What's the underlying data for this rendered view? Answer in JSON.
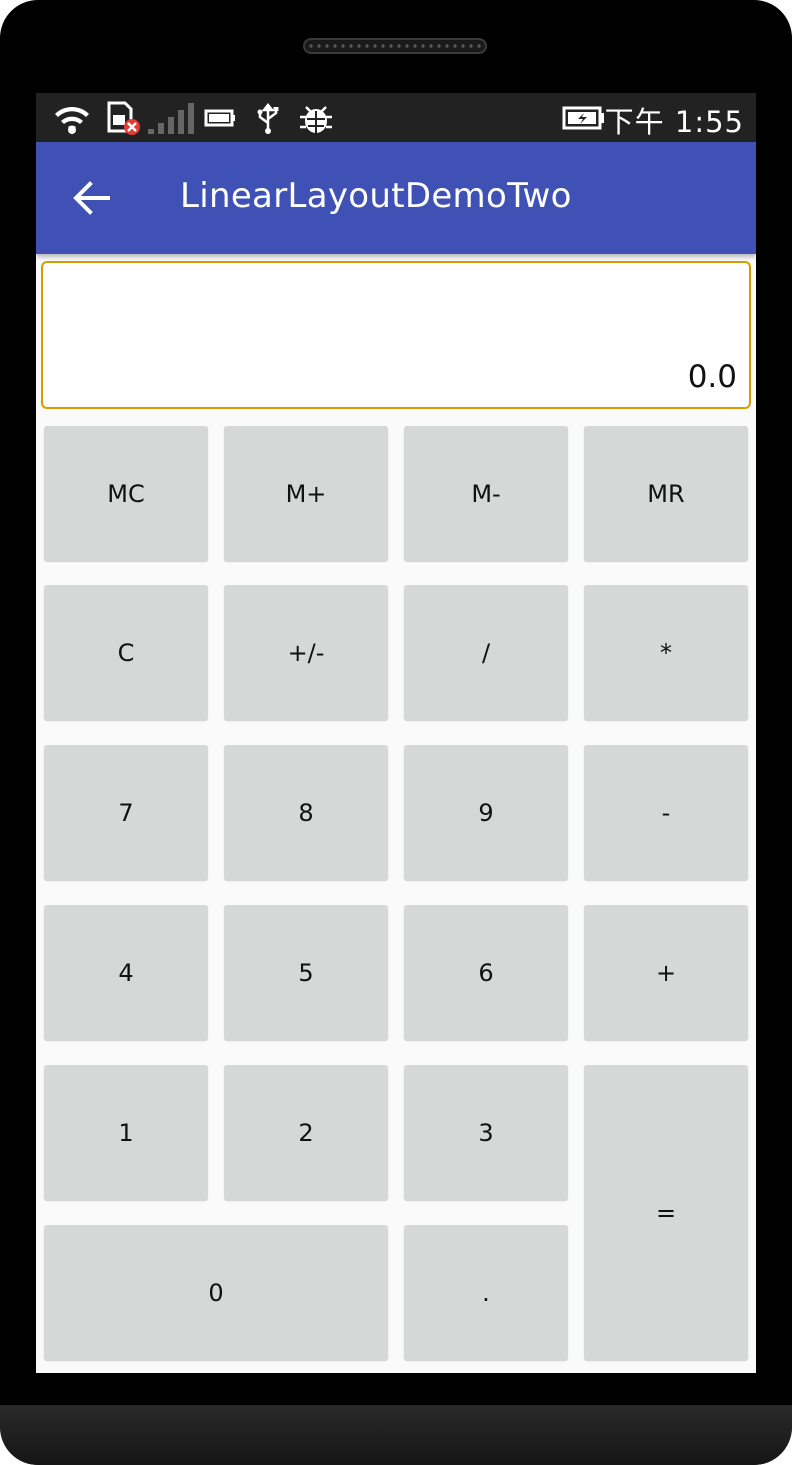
{
  "status_bar": {
    "time": "下午 1:55",
    "icons": [
      "wifi-icon",
      "sim-error-icon",
      "signal-icon",
      "battery-small-icon",
      "usb-icon",
      "debug-bug-icon",
      "battery-charging-icon"
    ]
  },
  "app_bar": {
    "title": "LinearLayoutDemoTwo",
    "back_icon": "arrow-left-icon",
    "color": "#3f51b5"
  },
  "display": {
    "value": "0.0",
    "border_color": "#d99b00"
  },
  "keys": {
    "mc": "MC",
    "m_plus": "M+",
    "m_minus": "M-",
    "mr": "MR",
    "clear": "C",
    "sign": "+/-",
    "divide": "/",
    "multiply": "*",
    "seven": "7",
    "eight": "8",
    "nine": "9",
    "minus": "-",
    "four": "4",
    "five": "5",
    "six": "6",
    "plus": "+",
    "one": "1",
    "two": "2",
    "three": "3",
    "equals": "=",
    "zero": "0",
    "dot": "."
  },
  "colors": {
    "key_background": "#d6d7d7",
    "screen_background": "#fafafa"
  }
}
